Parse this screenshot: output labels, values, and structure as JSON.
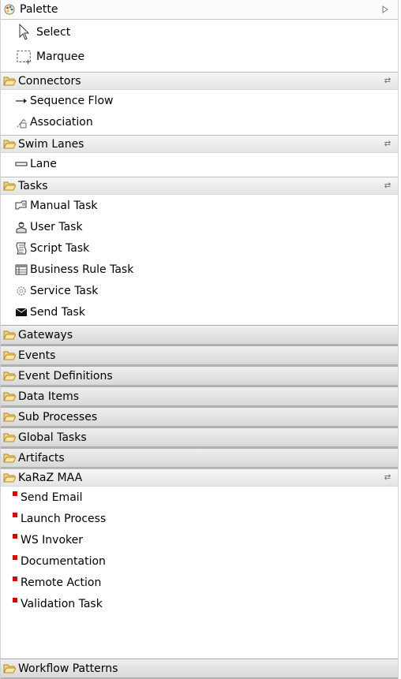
{
  "palette": {
    "title": "Palette",
    "tools": [
      {
        "label": "Select",
        "icon": "pointer-arrow-icon"
      },
      {
        "label": "Marquee",
        "icon": "marquee-selection-icon"
      }
    ]
  },
  "drawers": {
    "connectors": {
      "label": "Connectors",
      "items": [
        {
          "label": "Sequence Flow",
          "icon": "sequence-flow-icon"
        },
        {
          "label": "Association",
          "icon": "association-icon"
        }
      ]
    },
    "swim_lanes": {
      "label": "Swim Lanes",
      "items": [
        {
          "label": "Lane",
          "icon": "lane-icon"
        }
      ]
    },
    "tasks": {
      "label": "Tasks",
      "items": [
        {
          "label": "Manual Task",
          "icon": "manual-task-icon"
        },
        {
          "label": "User Task",
          "icon": "user-task-icon"
        },
        {
          "label": "Script Task",
          "icon": "script-task-icon"
        },
        {
          "label": "Business Rule Task",
          "icon": "business-rule-task-icon"
        },
        {
          "label": "Service Task",
          "icon": "service-task-icon"
        },
        {
          "label": "Send Task",
          "icon": "send-task-icon"
        }
      ]
    },
    "collapsed": [
      {
        "label": "Gateways"
      },
      {
        "label": "Events"
      },
      {
        "label": "Event Definitions"
      },
      {
        "label": "Data Items"
      },
      {
        "label": "Sub Processes"
      },
      {
        "label": "Global Tasks"
      },
      {
        "label": "Artifacts"
      }
    ],
    "karaz": {
      "label": "KaRaZ MAA",
      "items": [
        {
          "label": "Send Email"
        },
        {
          "label": "Launch Process"
        },
        {
          "label": "WS Invoker"
        },
        {
          "label": "Documentation"
        },
        {
          "label": "Remote Action"
        },
        {
          "label": "Validation Task"
        }
      ]
    },
    "workflow_patterns": {
      "label": "Workflow Patterns"
    }
  },
  "colors": {
    "karaz_marker": "#e00000",
    "folder": "#e8b64a"
  }
}
